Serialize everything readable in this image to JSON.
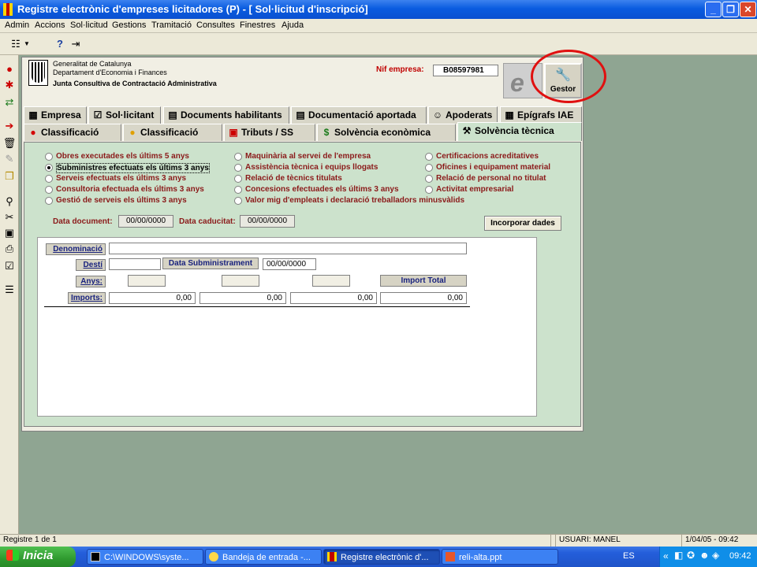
{
  "window": {
    "title": "Registre electrònic d'empreses licitadores (P) - [ Sol·licitud d'inscripció]",
    "controls": [
      "_",
      "❐",
      "✕"
    ]
  },
  "menu": [
    "Admin",
    "Accions",
    "Sol·licitud",
    "Gestions",
    "Tramitació",
    "Consultes",
    "Finestres",
    "Ajuda"
  ],
  "toolbar": {
    "icons": [
      "tree-view-icon",
      "dropdown-icon",
      "help-icon",
      "exit-icon"
    ]
  },
  "left_toolbar": {
    "icons": [
      "stop-icon",
      "run-icon",
      "refresh-icon",
      "import-icon",
      "delete-icon",
      "edit-icon",
      "copy-icon",
      "search-icon",
      "cut-icon",
      "save-icon",
      "print-icon",
      "properties-icon",
      "list-icon"
    ]
  },
  "header": {
    "org_line1": "Generalitat de Catalunya",
    "org_line2": "Departament d'Economia i Finances",
    "org_line3": "Junta Consultiva de Contractació Administrativa",
    "nif_label": "Nif empresa:",
    "nif_value": "B08597981",
    "gestor_label": "Gestor"
  },
  "tabs_row1": [
    "Empresa",
    "Sol·licitant",
    "Documents habilitants",
    "Documentació aportada",
    "Apoderats",
    "Epígrafs IAE"
  ],
  "tabs_row2": [
    "Classificació",
    "Classificació",
    "Tributs / SS",
    "Solvència econòmica",
    "Solvència tècnica"
  ],
  "active_tab": "Solvència tècnica",
  "options": {
    "col1": [
      "Obres executades els últims 5 anys",
      "Subministres efectuats els últims 3 anys",
      "Serveis efectuats els últims 3 anys",
      "Consultoria efectuada els últims 3 anys",
      "Gestió de serveis els últims 3 anys"
    ],
    "col2": [
      "Maquinària al servei de l'empresa",
      "Assistència tècnica i equips llogats",
      "Relació de tècnics titulats",
      "Concesions efectuades els últims 3 anys",
      "Valor mig d'empleats i declaració treballadors minusvàlids"
    ],
    "col3": [
      "Certificacions acreditatives",
      "Oficines i equipament material",
      "Relació de personal no titulat",
      "Activitat empresarial"
    ],
    "selected": "Subministres efectuats els últims 3 anys"
  },
  "dates": {
    "doc_label": "Data document:",
    "doc_value": "00/00/0000",
    "cad_label": "Data caducitat:",
    "cad_value": "00/00/0000",
    "incorporar_label": "Incorporar dades"
  },
  "detail": {
    "denominacio_label": "Denominació",
    "denominacio_value": "",
    "desti_label": "Destí",
    "desti_value": "",
    "data_subministrament_label": "Data Subministrament",
    "data_subministrament_value": "00/00/0000",
    "anys_label": "Anys:",
    "anys_values": [
      "",
      "",
      ""
    ],
    "import_total_label": "Import Total",
    "imports_label": "Imports:",
    "imports_values": [
      "0,00",
      "0,00",
      "0,00",
      "0,00"
    ]
  },
  "statusbar": {
    "record": "Registre 1 de 1",
    "user": "USUARI: MANEL",
    "datetime": "1/04/05 - 09:42"
  },
  "taskbar": {
    "start_label": "Inicia",
    "tasks": [
      "C:\\WINDOWS\\syste...",
      "Bandeja de entrada -...",
      "Registre electrònic d'...",
      "reli-alta.ppt"
    ],
    "active_task": 2,
    "language": "ES",
    "clock": "09:42"
  }
}
